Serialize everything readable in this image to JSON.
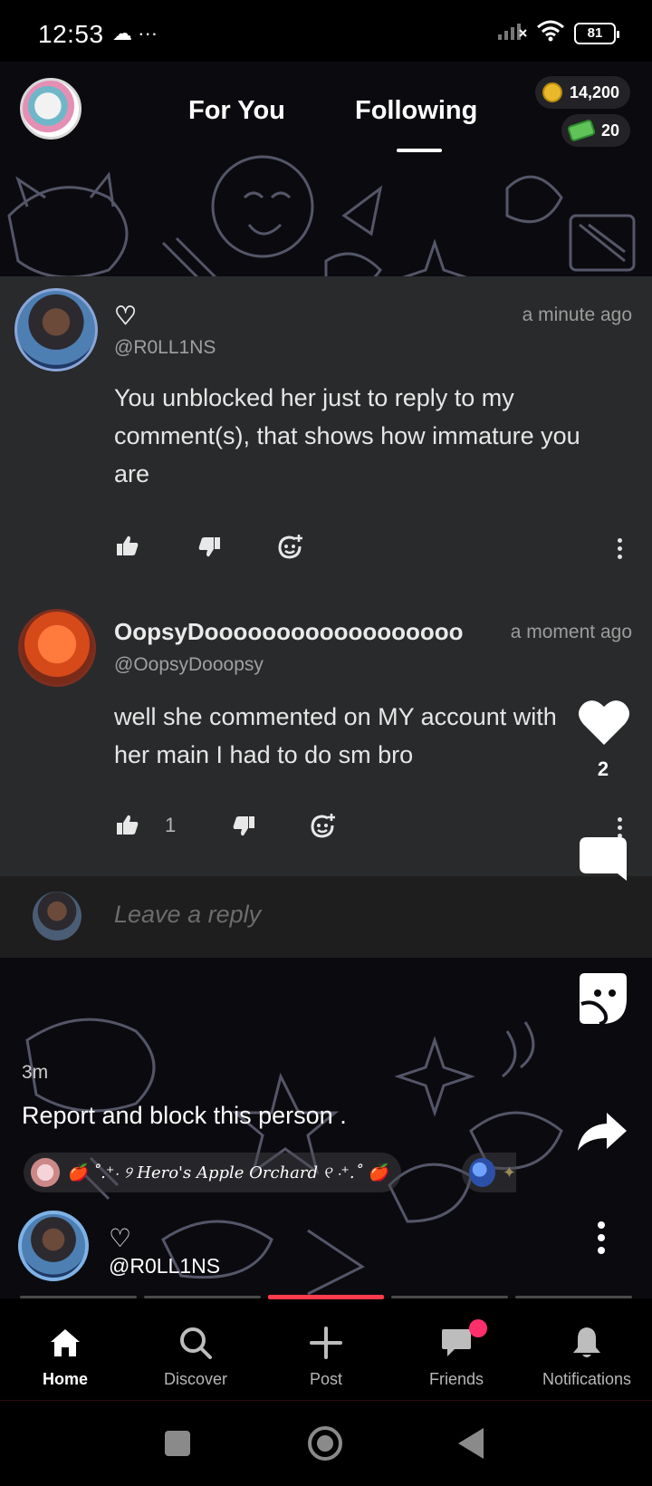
{
  "status_bar": {
    "time": "12:53",
    "left_icons": "☁ ···",
    "battery": "81"
  },
  "header": {
    "tabs": [
      {
        "label": "For You"
      },
      {
        "label": "Following"
      }
    ],
    "active_tab": "Following",
    "coins": "14,200",
    "cash": "20"
  },
  "comments": [
    {
      "name": "♡",
      "handle": "@R0LL1NS",
      "time": "a minute ago",
      "text": "You unblocked her just to reply to my comment(s), that shows how immature you are",
      "likes": ""
    },
    {
      "name": "OopsyDoooooooooooooooooo",
      "handle": "@OopsyDooopsy",
      "time": "a moment ago",
      "text": "well she commented on MY account with her main I had to do sm bro",
      "likes": "1"
    }
  ],
  "reply": {
    "placeholder": "Leave a reply"
  },
  "rail": {
    "like_count": "2"
  },
  "post": {
    "age": "3m",
    "caption": "Report and block this person .",
    "community_tag": "🍎 ˚.⁺‧ ୨ Hero's Apple Orchard ୧ ‧⁺.˚ 🍎",
    "author_name": "♡",
    "author_handle": "@R0LL1NS"
  },
  "progress": {
    "segments": 5,
    "active_index": 2
  },
  "bottom_nav": [
    {
      "label": "Home",
      "icon": "home-icon",
      "active": true
    },
    {
      "label": "Discover",
      "icon": "search-icon",
      "active": false
    },
    {
      "label": "Post",
      "icon": "plus-icon",
      "active": false
    },
    {
      "label": "Friends",
      "icon": "chat-icon",
      "active": false
    },
    {
      "label": "Notifications",
      "icon": "bell-icon",
      "active": false
    }
  ],
  "colors": {
    "accent": "#ff3b4d",
    "panel": "#292a2b",
    "notification_dot": "#ff2f6b"
  }
}
